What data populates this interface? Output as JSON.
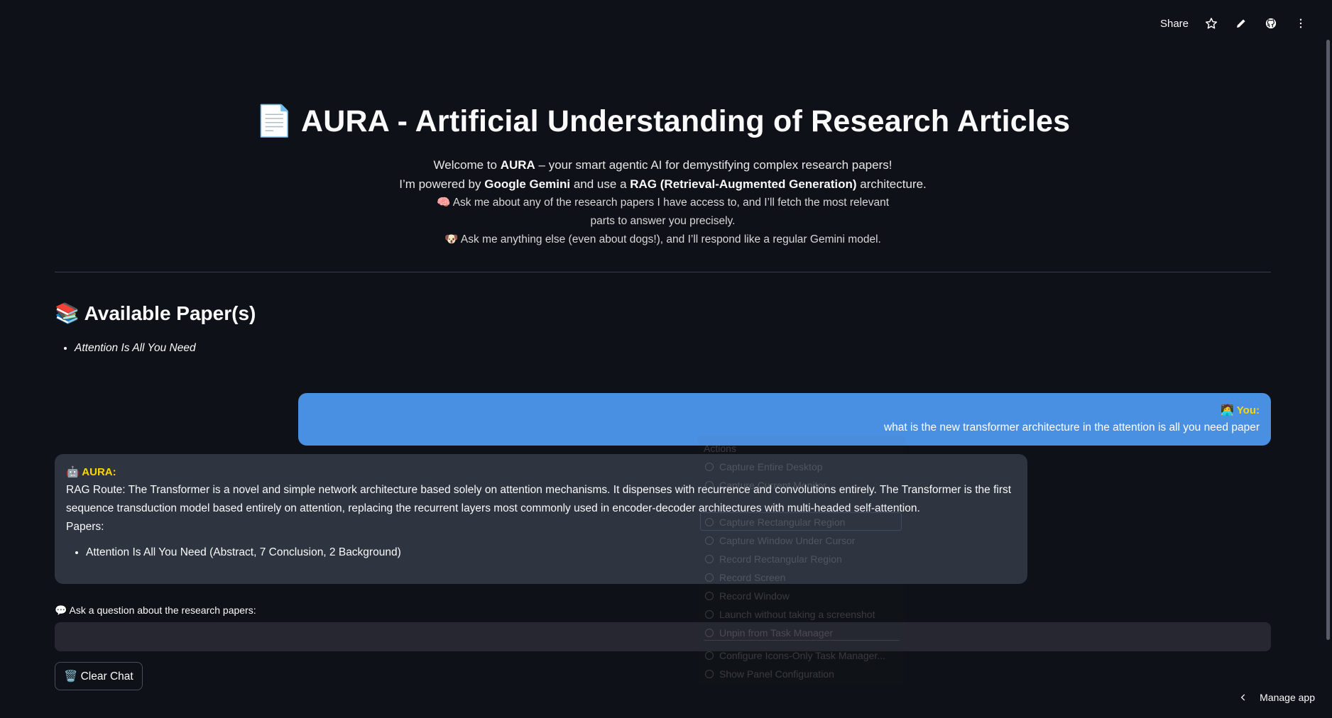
{
  "toolbar": {
    "share_label": "Share",
    "icons": [
      "star-icon",
      "pencil-icon",
      "github-icon",
      "more-vertical-icon"
    ]
  },
  "header": {
    "title_emoji": "📄",
    "title": "AURA - Artificial Understanding of Research Articles"
  },
  "intro": {
    "line1_pre": "Welcome to ",
    "line1_bold": "AURA",
    "line1_post": " – your smart agentic AI for demystifying complex research papers!",
    "line2_pre": "I’m powered by ",
    "line2_bold1": "Google Gemini",
    "line2_mid": " and use a ",
    "line2_bold2": "RAG (Retrieval-Augmented Generation)",
    "line2_post": " architecture.",
    "line3": "🧠 Ask me about any of the research papers I have access to, and I’ll fetch the most relevant parts to answer you precisely.",
    "line4": "🐶 Ask me anything else (even about dogs!), and I’ll respond like a regular Gemini model."
  },
  "papers": {
    "heading": "📚 Available Paper(s)",
    "items": [
      "Attention Is All You Need"
    ]
  },
  "chat": {
    "user": {
      "label": "🧑‍💻 You:",
      "text": "what is the new transformer architecture in the attention is all you need paper"
    },
    "bot": {
      "label": "🤖 AURA:",
      "text": "RAG Route: The Transformer is a novel and simple network architecture based solely on attention mechanisms. It dispenses with recurrence and convolutions entirely. The Transformer is the first sequence transduction model based entirely on attention, replacing the recurrent layers most commonly used in encoder-decoder architectures with multi-headed self-attention.",
      "papers_label": "Papers:",
      "sources": [
        "Attention Is All You Need (Abstract, 7 Conclusion, 2 Background)"
      ]
    }
  },
  "input": {
    "label": "💬 Ask a question about the research papers:",
    "value": "",
    "placeholder": ""
  },
  "clear_button": {
    "label": "🗑️ Clear Chat"
  },
  "manage_app": {
    "label": "Manage app"
  },
  "ghost_menu": {
    "title": "Actions",
    "items": [
      "Capture Entire Desktop",
      "Capture Current Monitor",
      "Capture Rectangular Region",
      "Capture Window Under Cursor",
      "Record Rectangular Region",
      "Record Screen",
      "Record Window",
      "Launch without taking a screenshot",
      "Unpin from Task Manager",
      "Configure Icons-Only Task Manager...",
      "Show Panel Configuration"
    ]
  },
  "colors": {
    "background": "#0e1117",
    "user_bubble": "#4a90e2",
    "bot_bubble": "#2e3440",
    "speaker_label": "#ffd700",
    "input_bg": "#262730"
  }
}
